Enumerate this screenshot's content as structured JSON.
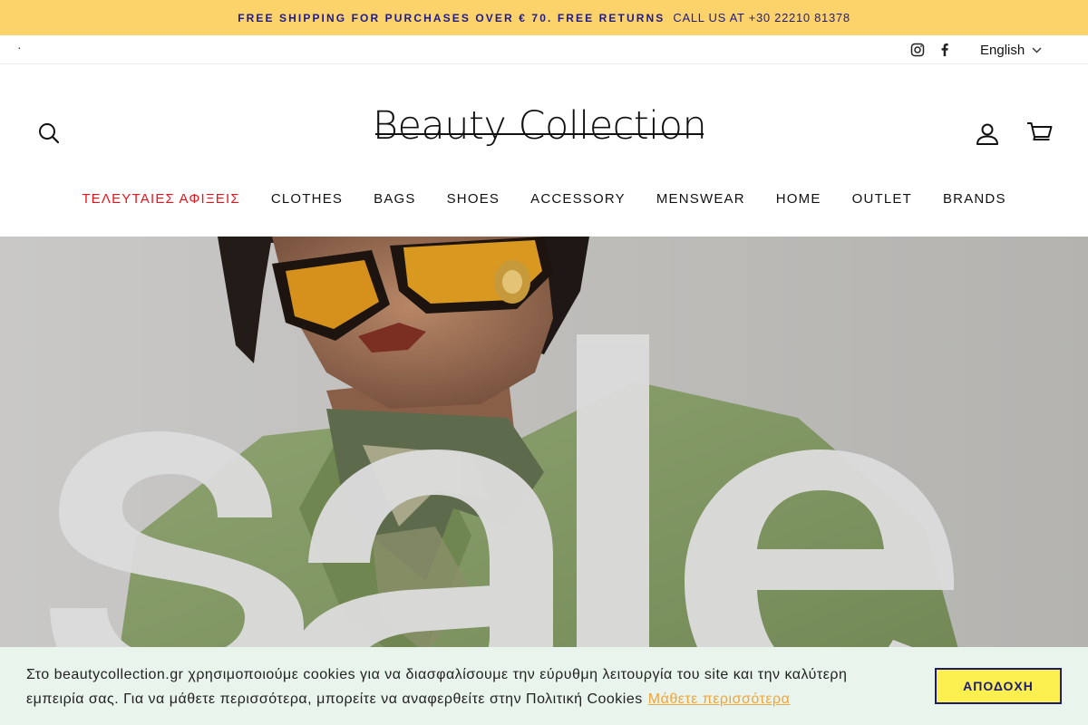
{
  "announcement": {
    "promo": "FREE SHIPPING FOR PURCHASES OVER € 70. FREE RETURNS",
    "call": "CALL US AT +30 22210 81378"
  },
  "utility": {
    "dot": "·",
    "social": [
      "instagram-icon",
      "facebook-icon"
    ],
    "social_labels": [
      "Instagram",
      "Facebook"
    ],
    "language": "English"
  },
  "header": {
    "logo": "Beauty Collection",
    "search_label": "Search",
    "account_label": "Log in",
    "cart_label": "Cart",
    "nav": [
      {
        "label": "ΤΕΛΕΥΤΑΙΕΣ ΑΦΙΞΕΙΣ",
        "highlight": true
      },
      {
        "label": "CLOTHES"
      },
      {
        "label": "BAGS"
      },
      {
        "label": "SHOES"
      },
      {
        "label": "ACCESSORY"
      },
      {
        "label": "MENSWEAR"
      },
      {
        "label": "HOME"
      },
      {
        "label": "OUTLET"
      },
      {
        "label": "BRANDS"
      }
    ]
  },
  "hero": {
    "word": "sale"
  },
  "cookie": {
    "message": "Στο beautycollection.gr χρησιμοποιούμε cookies για να διασφαλίσουμε την εύρυθμη λειτουργία του site και την καλύτερη εμπειρία σας. Για να μάθετε περισσότερα, μπορείτε να αναφερθείτε στην Πολιτική Cookies",
    "learn_more": "Μάθετε περισσότερα",
    "accept": "ΑΠΟΔΟΧΗ"
  },
  "colors": {
    "announcement_bg": "#fcd36b",
    "announcement_text": "#1f1a8a",
    "nav_highlight": "#e8141c",
    "cookie_bg": "#e9f5ec",
    "cookie_link": "#f0a43a",
    "accept_bg": "#fcf050"
  }
}
